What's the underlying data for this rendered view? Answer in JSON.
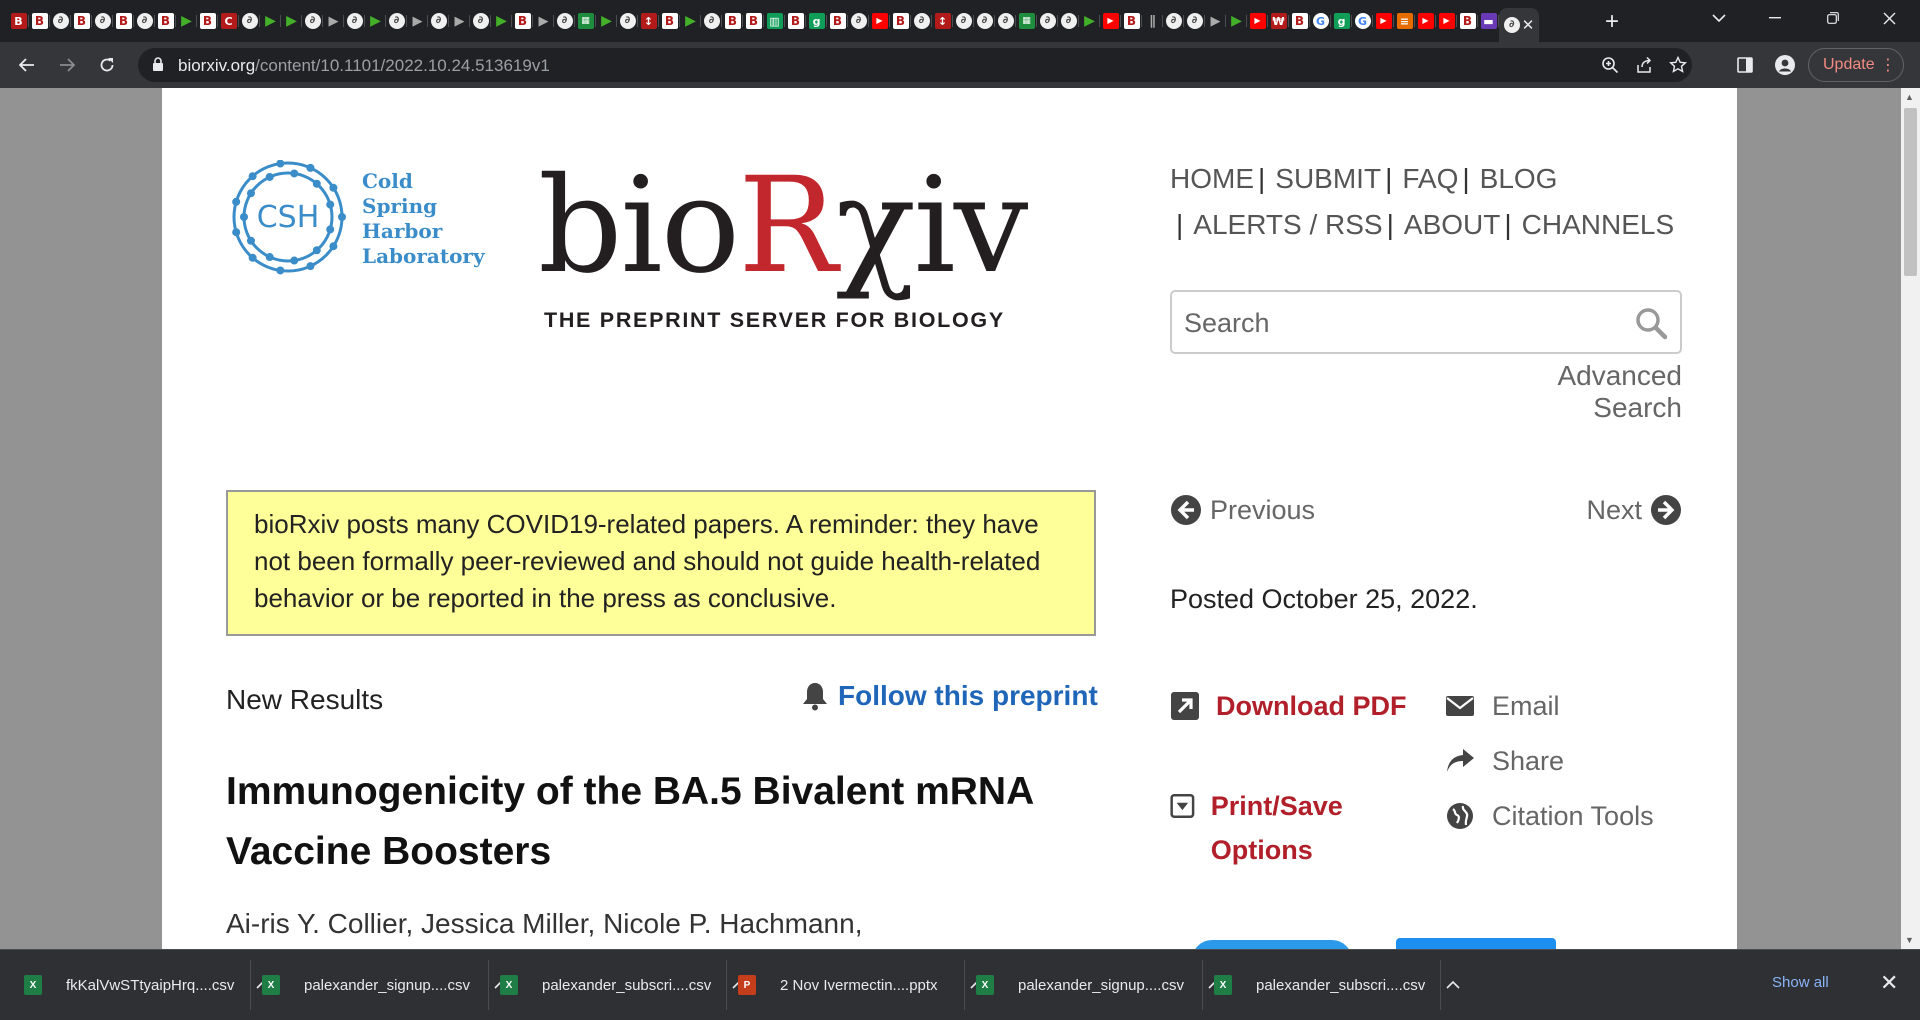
{
  "browser": {
    "tabs": [
      {
        "kind": "b",
        "glyph": "B"
      },
      {
        "kind": "bw",
        "glyph": "B"
      },
      {
        "kind": "bio",
        "glyph": "∂"
      },
      {
        "kind": "bw",
        "glyph": "B"
      },
      {
        "kind": "bio",
        "glyph": "∂"
      },
      {
        "kind": "bw",
        "glyph": "B"
      },
      {
        "kind": "bio",
        "glyph": "∂"
      },
      {
        "kind": "bw",
        "glyph": "B"
      },
      {
        "kind": "play",
        "glyph": "▶"
      },
      {
        "kind": "bw",
        "glyph": "B"
      },
      {
        "kind": "b",
        "glyph": "C"
      },
      {
        "kind": "bio",
        "glyph": "∂"
      },
      {
        "kind": "play",
        "glyph": "▶"
      },
      {
        "kind": "play",
        "glyph": "▶"
      },
      {
        "kind": "bio",
        "glyph": "∂"
      },
      {
        "kind": "gplay",
        "glyph": "▶"
      },
      {
        "kind": "bio",
        "glyph": "∂"
      },
      {
        "kind": "play",
        "glyph": "▶"
      },
      {
        "kind": "bio",
        "glyph": "∂"
      },
      {
        "kind": "gplay",
        "glyph": "▶"
      },
      {
        "kind": "bio",
        "glyph": "∂"
      },
      {
        "kind": "gplay",
        "glyph": "▶"
      },
      {
        "kind": "bio",
        "glyph": "∂"
      },
      {
        "kind": "play",
        "glyph": "▶"
      },
      {
        "kind": "bw",
        "glyph": "B"
      },
      {
        "kind": "gplay",
        "glyph": "▶"
      },
      {
        "kind": "bio",
        "glyph": "∂"
      },
      {
        "kind": "sheet",
        "glyph": "▦"
      },
      {
        "kind": "play",
        "glyph": "▶"
      },
      {
        "kind": "bio",
        "glyph": "∂"
      },
      {
        "kind": "b",
        "glyph": "↕"
      },
      {
        "kind": "bw",
        "glyph": "B"
      },
      {
        "kind": "play",
        "glyph": "▶"
      },
      {
        "kind": "bio",
        "glyph": "∂"
      },
      {
        "kind": "bw",
        "glyph": "B"
      },
      {
        "kind": "bw",
        "glyph": "B"
      },
      {
        "kind": "grn",
        "glyph": "▥"
      },
      {
        "kind": "bw",
        "glyph": "B"
      },
      {
        "kind": "grn",
        "glyph": "g"
      },
      {
        "kind": "bw",
        "glyph": "B"
      },
      {
        "kind": "bio",
        "glyph": "∂"
      },
      {
        "kind": "yt",
        "glyph": "▶"
      },
      {
        "kind": "bw",
        "glyph": "B"
      },
      {
        "kind": "bio",
        "glyph": "∂"
      },
      {
        "kind": "b",
        "glyph": "↕"
      },
      {
        "kind": "bio",
        "glyph": "∂"
      },
      {
        "kind": "bio",
        "glyph": "∂"
      },
      {
        "kind": "bio",
        "glyph": "∂"
      },
      {
        "kind": "sheet",
        "glyph": "▦"
      },
      {
        "kind": "bio",
        "glyph": "∂"
      },
      {
        "kind": "bio",
        "glyph": "∂"
      },
      {
        "kind": "play",
        "glyph": "▶"
      },
      {
        "kind": "yt",
        "glyph": "▶"
      },
      {
        "kind": "bw",
        "glyph": "B"
      },
      {
        "kind": "gplay",
        "glyph": "∥"
      },
      {
        "kind": "bio",
        "glyph": "∂"
      },
      {
        "kind": "bio",
        "glyph": "∂"
      },
      {
        "kind": "gplay",
        "glyph": "▶"
      },
      {
        "kind": "play",
        "glyph": "▶"
      },
      {
        "kind": "yt",
        "glyph": "▶"
      },
      {
        "kind": "b",
        "glyph": "₩"
      },
      {
        "kind": "bw",
        "glyph": "B"
      },
      {
        "kind": "g",
        "glyph": "G"
      },
      {
        "kind": "grn",
        "glyph": "g"
      },
      {
        "kind": "g",
        "glyph": "G"
      },
      {
        "kind": "yt",
        "glyph": "▶"
      },
      {
        "kind": "or",
        "glyph": "≡"
      },
      {
        "kind": "yt",
        "glyph": "▶"
      },
      {
        "kind": "yt",
        "glyph": "▶"
      },
      {
        "kind": "bw",
        "glyph": "B"
      },
      {
        "kind": "pu",
        "glyph": "▬"
      }
    ],
    "active_tab_icon": "close-icon",
    "url_host": "biorxiv.org",
    "url_path": "/content/10.1101/2022.10.24.513619v1",
    "update_label": "Update"
  },
  "site": {
    "csh_initials": "CSH",
    "csh_lines": [
      "Cold",
      "Spring",
      "Harbor",
      "Laboratory"
    ],
    "brand_pre": "bio",
    "brand_r": "R",
    "brand_post": "χiv",
    "tagline": "THE PREPRINT SERVER FOR BIOLOGY",
    "nav": [
      "HOME",
      "SUBMIT",
      "FAQ",
      "BLOG",
      "ALERTS / RSS",
      "ABOUT",
      "CHANNELS"
    ],
    "search_placeholder": "Search",
    "advanced_search": "Advanced Search"
  },
  "article": {
    "covid_note": "bioRxiv posts many COVID19-related papers. A reminder: they have not been formally peer-reviewed and should not guide health-related behavior or be reported in the press as conclusive.",
    "type": "New Results",
    "follow": "Follow this preprint",
    "title": "Immunogenicity of the BA.5 Bivalent mRNA Vaccine Boosters",
    "authors": "Ai-ris Y. Collier, Jessica Miller, Nicole P. Hachmann,"
  },
  "sidebar": {
    "previous": "Previous",
    "next": "Next",
    "posted": "Posted October 25, 2022.",
    "download_pdf": "Download PDF",
    "print_save": "Print/Save Options",
    "email": "Email",
    "share": "Share",
    "citation": "Citation Tools"
  },
  "downloads": {
    "items": [
      {
        "type": "xlsx",
        "name": "fkKalVwSTtyaipHrq....csv"
      },
      {
        "type": "xlsx",
        "name": "palexander_signup....csv"
      },
      {
        "type": "xlsx",
        "name": "palexander_subscri....csv"
      },
      {
        "type": "pptx",
        "name": "2 Nov Ivermectin....pptx"
      },
      {
        "type": "xlsx",
        "name": "palexander_signup....csv"
      },
      {
        "type": "xlsx",
        "name": "palexander_subscri....csv"
      }
    ],
    "show_all": "Show all"
  },
  "colors": {
    "brand_red": "#c1272d",
    "link_blue": "#1f65b8",
    "action_red": "#b1202a",
    "note_yellow": "#ffff99",
    "csh_blue": "#3a8dc8"
  }
}
